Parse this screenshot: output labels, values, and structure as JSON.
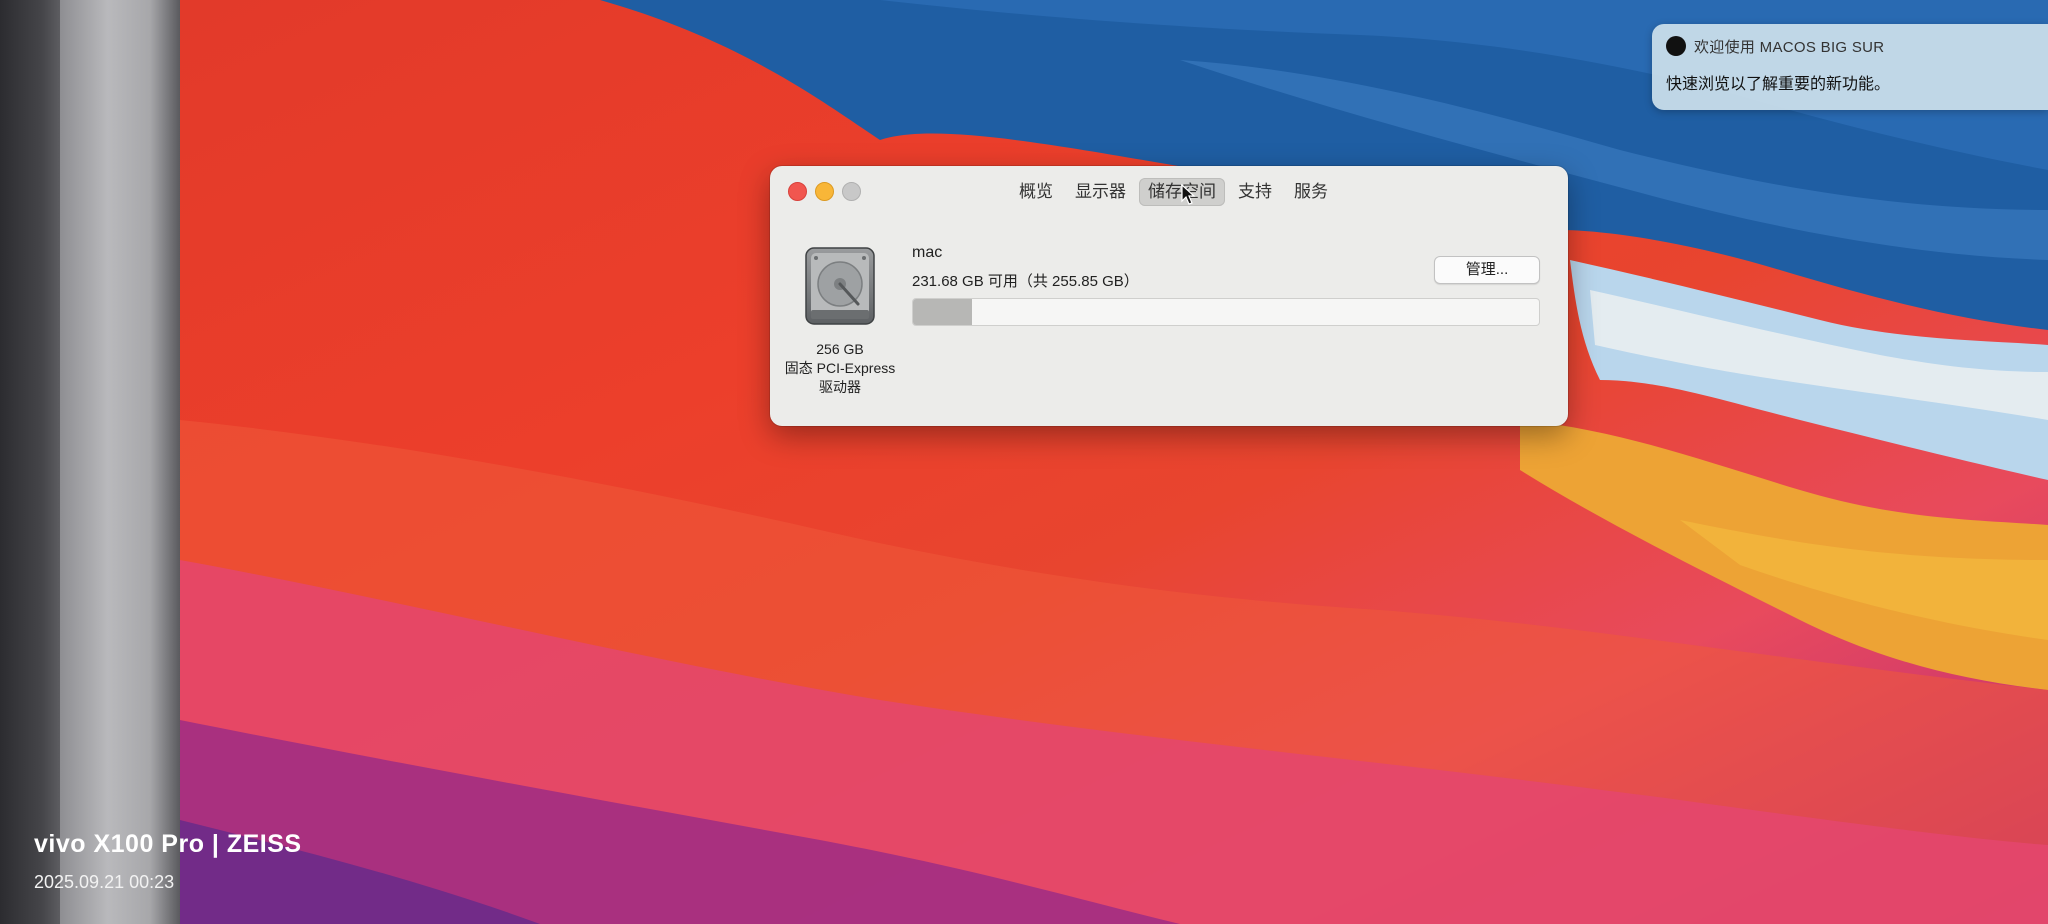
{
  "notification": {
    "title": "欢迎使用 MACOS BIG SUR",
    "body": "快速浏览以了解重要的新功能。"
  },
  "window": {
    "tabs": [
      {
        "label": "概览",
        "active": false
      },
      {
        "label": "显示器",
        "active": false
      },
      {
        "label": "储存空间",
        "active": true
      },
      {
        "label": "支持",
        "active": false
      },
      {
        "label": "服务",
        "active": false
      }
    ],
    "disk": {
      "size": "256 GB",
      "type": "固态 PCI-Express",
      "kind": "驱动器"
    },
    "volume": {
      "name": "mac",
      "availability": "231.68 GB 可用（共 255.85 GB）",
      "used_fraction": 0.094
    },
    "manage_label": "管理..."
  },
  "watermark": {
    "brand": "vivo X100 Pro | ZEISS",
    "datetime": "2025.09.21 00:23"
  },
  "colors": {
    "close": "#f1564f",
    "minimize": "#f8b638",
    "zoom_disabled": "#c8c8c8"
  }
}
